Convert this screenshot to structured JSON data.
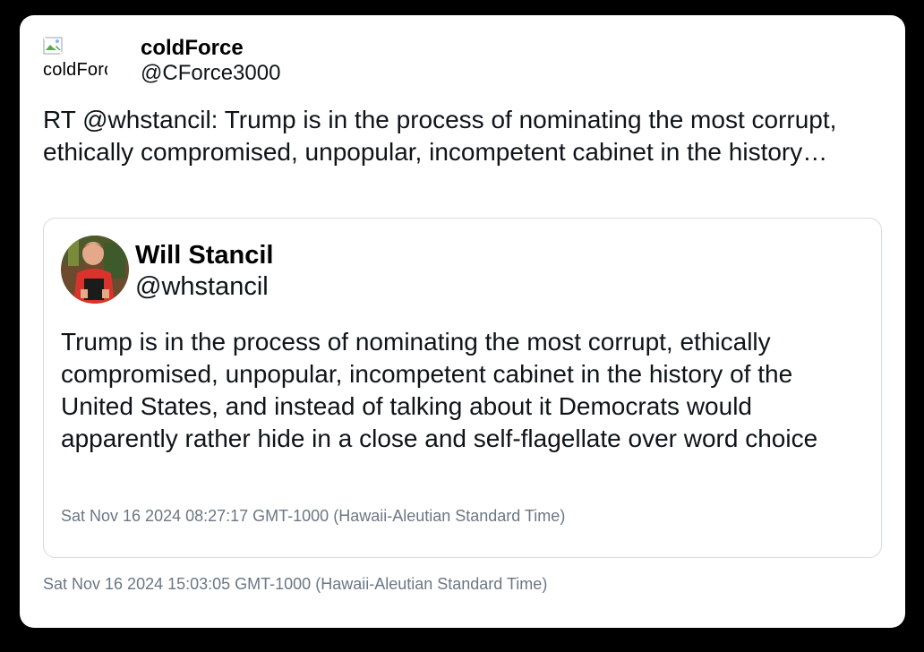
{
  "tweet": {
    "author": {
      "display_name": "coldForce",
      "handle": "@CForce3000",
      "avatar_alt": "coldForce"
    },
    "text": "RT @whstancil: Trump is in the process of nominating the most corrupt, ethically compromised, unpopular, incompetent cabinet in the history…",
    "timestamp": "Sat Nov 16 2024 15:03:05 GMT-1000 (Hawaii-Aleutian Standard Time)"
  },
  "quoted_tweet": {
    "author": {
      "display_name": "Will Stancil",
      "handle": "@whstancil",
      "avatar_alt": "Will Stancil"
    },
    "text": "Trump is in the process of nominating the most corrupt, ethically compromised, unpopular, incompetent cabinet in the history of the United States, and instead of talking about it Democrats would apparently rather hide in a close and self-flagellate over word choice",
    "timestamp": "Sat Nov 16 2024 08:27:17 GMT-1000 (Hawaii-Aleutian Standard Time)"
  },
  "icons": {
    "broken_avatar": "broken-image-icon"
  },
  "colors": {
    "background": "#000000",
    "card": "#ffffff",
    "text": "#0f1419",
    "muted": "#6b7785",
    "border": "#d5dbe0"
  }
}
